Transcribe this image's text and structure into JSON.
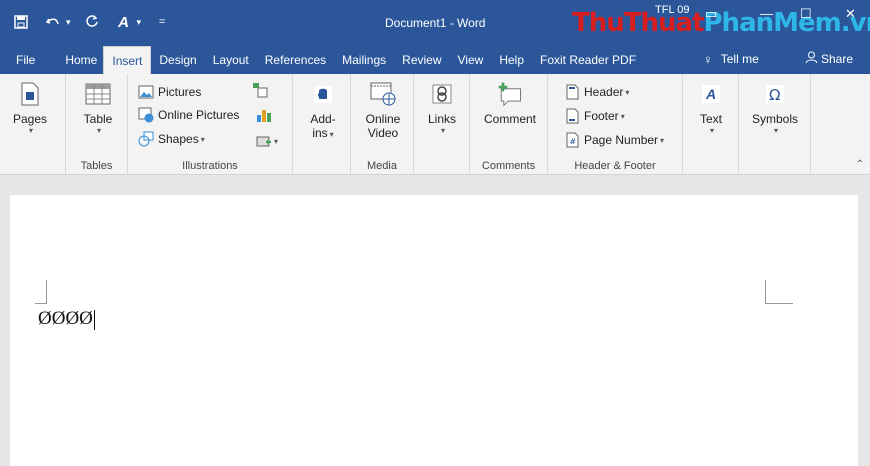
{
  "title_bar": {
    "document_title": "Document1  -  Word",
    "watermark_part1": "Thu",
    "watermark_part2": "Thuat",
    "watermark_part3": "Phan",
    "watermark_part4": "Mem",
    "watermark_part5": ".vn",
    "account_label": "TFL 09",
    "minimize_glyph": "—",
    "restore_glyph": "☐",
    "close_glyph": "✕"
  },
  "qat": {
    "save_icon": "save-icon",
    "undo_icon": "undo-icon",
    "redo_icon": "redo-icon",
    "format_icon": "text-format-icon",
    "customize_glyph": "="
  },
  "tabs": [
    {
      "label": "File"
    },
    {
      "label": "Home"
    },
    {
      "label": "Insert"
    },
    {
      "label": "Design"
    },
    {
      "label": "Layout"
    },
    {
      "label": "References"
    },
    {
      "label": "Mailings"
    },
    {
      "label": "Review"
    },
    {
      "label": "View"
    },
    {
      "label": "Help"
    },
    {
      "label": "Foxit Reader PDF"
    }
  ],
  "tell_me": "Tell me",
  "share": "Share",
  "ribbon": {
    "pages": {
      "label": "Pages",
      "group": ""
    },
    "tables": {
      "label": "Table",
      "group": "Tables"
    },
    "illustrations": {
      "group": "Illustrations",
      "pictures": "Pictures",
      "online_pictures": "Online Pictures",
      "shapes": "Shapes"
    },
    "addins": {
      "label1": "Add-",
      "label2": "ins",
      "group": ""
    },
    "media": {
      "label1": "Online",
      "label2": "Video",
      "group": "Media"
    },
    "links": {
      "label": "Links",
      "group": ""
    },
    "comments": {
      "label": "Comment",
      "group": "Comments"
    },
    "header_footer": {
      "group": "Header & Footer",
      "header": "Header",
      "footer": "Footer",
      "page_number": "Page Number"
    },
    "text": {
      "label": "Text"
    },
    "symbols": {
      "label": "Symbols"
    }
  },
  "document": {
    "content": "ØØØØ"
  },
  "colors": {
    "accent": "#2b579a",
    "ribbon_bg": "#f3f3f3"
  }
}
